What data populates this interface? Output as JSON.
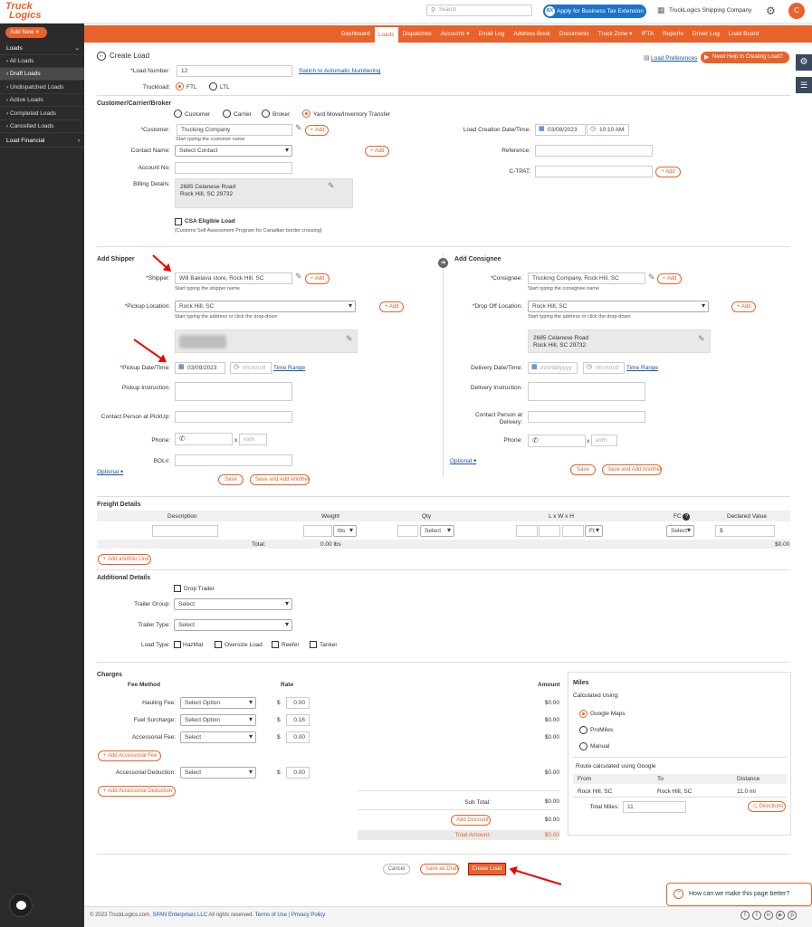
{
  "brand": {
    "logo_line1": "Truck",
    "logo_line2": "Logics"
  },
  "topbar": {
    "search_placeholder": "Search",
    "tax_button": "Apply for Business Tax Extension",
    "company": "TruckLogics Shipping Company",
    "avatar": "C"
  },
  "nav": {
    "items": [
      "Dashboard",
      "Loads",
      "Dispatches",
      "Accounts ▾",
      "Email Log",
      "Address Book",
      "Documents",
      "Truck Zone ▾",
      "IFTA",
      "Reports",
      "Driver Log",
      "Load Board"
    ],
    "active": "Loads"
  },
  "sidebar": {
    "add_new": "Add New",
    "section": "Loads",
    "items": [
      "All Loads",
      "Draft Loads",
      "Undispatched Loads",
      "Active Loads",
      "Completed Loads",
      "Cancelled Loads"
    ],
    "active": "Draft Loads",
    "section2": "Load Financial"
  },
  "page": {
    "title": "Create Load",
    "load_pref": "Load Preferences",
    "help_btn": "Need Help In Creating Load?",
    "load_number_label": "Load Number:",
    "load_number": "12",
    "auto_number": "Switch to Automatic Numbering",
    "truckload_label": "Truckload:",
    "ftl": "FTL",
    "ltl": "LTL"
  },
  "ccb": {
    "title": "Customer/Carrier/Broker",
    "opts": [
      "Customer",
      "Carrier",
      "Broker",
      "Yard Move/Inventory Transfer"
    ],
    "customer_label": "Customer:",
    "customer": "Trucking Company",
    "customer_help": "Start typing the customer name",
    "add": "+ Add",
    "contact_label": "Contact Name:",
    "contact": "Select Contact",
    "account_label": "Account No:",
    "billing_label": "Billing Details:",
    "billing_line1": "2685 Celanese Road",
    "billing_line2": "Rock Hill, SC 29732",
    "csa_label": "CSA Eligible Load",
    "csa_help": "(Customs Self Assessment Program for Canadian border crossing)",
    "creation_label": "Load Creation Date/Time:",
    "creation_date": "03/08/2023",
    "creation_time": "10:10 AM",
    "reference_label": "Reference:",
    "ctpat_label": "C-TPAT:"
  },
  "shipper": {
    "title": "Add Shipper",
    "shipper_label": "Shipper:",
    "shipper": "Will Baklava store, Rock Hill, SC",
    "shipper_help": "Start typing the shipper name",
    "pickup_loc_label": "Pickup Location:",
    "pickup_loc": "Rock Hill, SC",
    "loc_help": "Start typing the address or click the drop-down",
    "date_label": "Pickup Date/Time:",
    "date": "03/09/2023",
    "time_ph": "hh:mm:tt",
    "time_range": "Time Range",
    "instr_label": "Pickup Instruction:",
    "contact_label": "Contact Person at PickUp:",
    "phone_label": "Phone:",
    "ext_ph": "extn",
    "bol_label": "BOL#:",
    "optional": "Optional ▾",
    "save": "Save",
    "save_add": "Save and Add Another"
  },
  "consignee": {
    "title": "Add Consignee",
    "consignee_label": "Consignee:",
    "consignee": "Trucking Company, Rock Hill, SC",
    "consignee_help": "Start typing the consignee name",
    "drop_label": "Drop Off Location:",
    "drop": "Rock Hill, SC",
    "loc_help": "Start typing the address or click the drop-down",
    "addr_line1": "2685 Celanese Road",
    "addr_line2": "Rock Hill, SC 29732",
    "date_label": "Delivery Date/Time:",
    "date_ph": "mm/dd/yyyy",
    "time_ph": "hh:mm:tt",
    "time_range": "Time Range",
    "instr_label": "Delivery Instruction:",
    "contact_label1": "Contact Person at",
    "contact_label2": "Delivery:",
    "phone_label": "Phone:",
    "ext_ph": "extn",
    "optional": "Optional ▾",
    "save": "Save",
    "save_add": "Save and Add Another"
  },
  "freight": {
    "title": "Freight Details",
    "headers": [
      "Description",
      "Weight",
      "Qty",
      "L x W x H",
      "FC",
      "Declared Value"
    ],
    "weight_unit": "lbs",
    "qty_select": "Select",
    "dim_unit": "Ft",
    "fc_select": "Select",
    "currency": "$",
    "total_label": "Total:",
    "total_weight": "0.00 lbs",
    "total_value": "$0.00",
    "add_line": "+ Add another Line"
  },
  "additional": {
    "title": "Additional Details",
    "drop_trailer": "Drop Trailer",
    "group_label": "Trailer Group:",
    "group": "Select",
    "type_label": "Trailer Type:",
    "type": "Select",
    "load_type_label": "Load Type:",
    "types": [
      "HazMat",
      "Oversize Load",
      "Reefer",
      "Tanker"
    ]
  },
  "charges": {
    "title": "Charges",
    "fee_method": "Fee Method",
    "rate": "Rate",
    "amount": "Amount",
    "rows": [
      {
        "label": "Hauling Fee:",
        "select": "Select Option",
        "rate": "0.00",
        "amount": "$0.00"
      },
      {
        "label": "Fuel Surcharge:",
        "select": "Select Option",
        "rate": "0.16",
        "amount": "$0.00"
      },
      {
        "label": "Accessorial Fee:",
        "select": "Select",
        "rate": "0.00",
        "amount": "$0.00"
      }
    ],
    "add_acc_fee": "+ Add Accessorial Fee",
    "deduction": {
      "label": "Accessorial Deduction:",
      "select": "Select",
      "rate": "0.00",
      "amount": "$0.00"
    },
    "add_acc_ded": "+ Add Accessorial Deduction",
    "subtotal_label": "Sub Total:",
    "subtotal": "$0.00",
    "add_discount": "Add Discount",
    "discount": "$0.00",
    "total_label": "Total Amount:",
    "total": "$0.00"
  },
  "miles": {
    "title": "Miles",
    "calc_label": "Calculated Using:",
    "opts": [
      "Google Maps",
      "ProMiles",
      "Manual"
    ],
    "route_label": "Route calculated using Google",
    "headers": [
      "From",
      "To",
      "Distance"
    ],
    "from": "Rock Hill, SC",
    "to": "Rock Hill, SC",
    "distance": "11.0 mi",
    "total_label": "Total Miles:",
    "total": "11",
    "directions": "Directions"
  },
  "actions": {
    "cancel": "Cancel",
    "draft": "Save as Draft",
    "create": "Create Load"
  },
  "feedback": "How can we make this page better?",
  "footer": {
    "copy": "© 2023 TruckLogics.com,",
    "span": "SPAN Enterprises LLC",
    "rights": "All rights reserved.",
    "terms": "Terms of Use",
    "sep": "|",
    "privacy": "Privacy Policy"
  },
  "colors": {
    "accent": "#e8632b",
    "sidebar": "#2b2b2b",
    "link": "#1a56a6"
  }
}
